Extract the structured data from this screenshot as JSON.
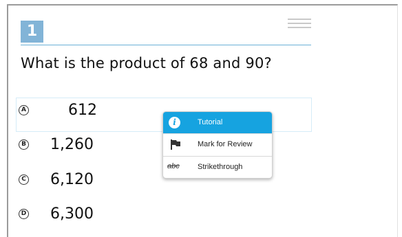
{
  "question": {
    "number": "1",
    "text": "What is the product of 68 and 90?"
  },
  "options": [
    {
      "letter": "A",
      "value": "612"
    },
    {
      "letter": "B",
      "value": "1,260"
    },
    {
      "letter": "C",
      "value": "6,120"
    },
    {
      "letter": "D",
      "value": "6,300"
    }
  ],
  "context_menu": {
    "items": [
      {
        "label": "Tutorial",
        "icon": "info-icon",
        "state": "highlighted"
      },
      {
        "label": "Mark for Review",
        "icon": "flag-icon"
      },
      {
        "label": "Strikethrough",
        "icon": "strikethrough-icon",
        "icon_text": "abc"
      }
    ]
  },
  "colors": {
    "question_number_bg": "#82b4d7",
    "accent": "#16a3e0",
    "header_rule": "#6ab0d6"
  }
}
